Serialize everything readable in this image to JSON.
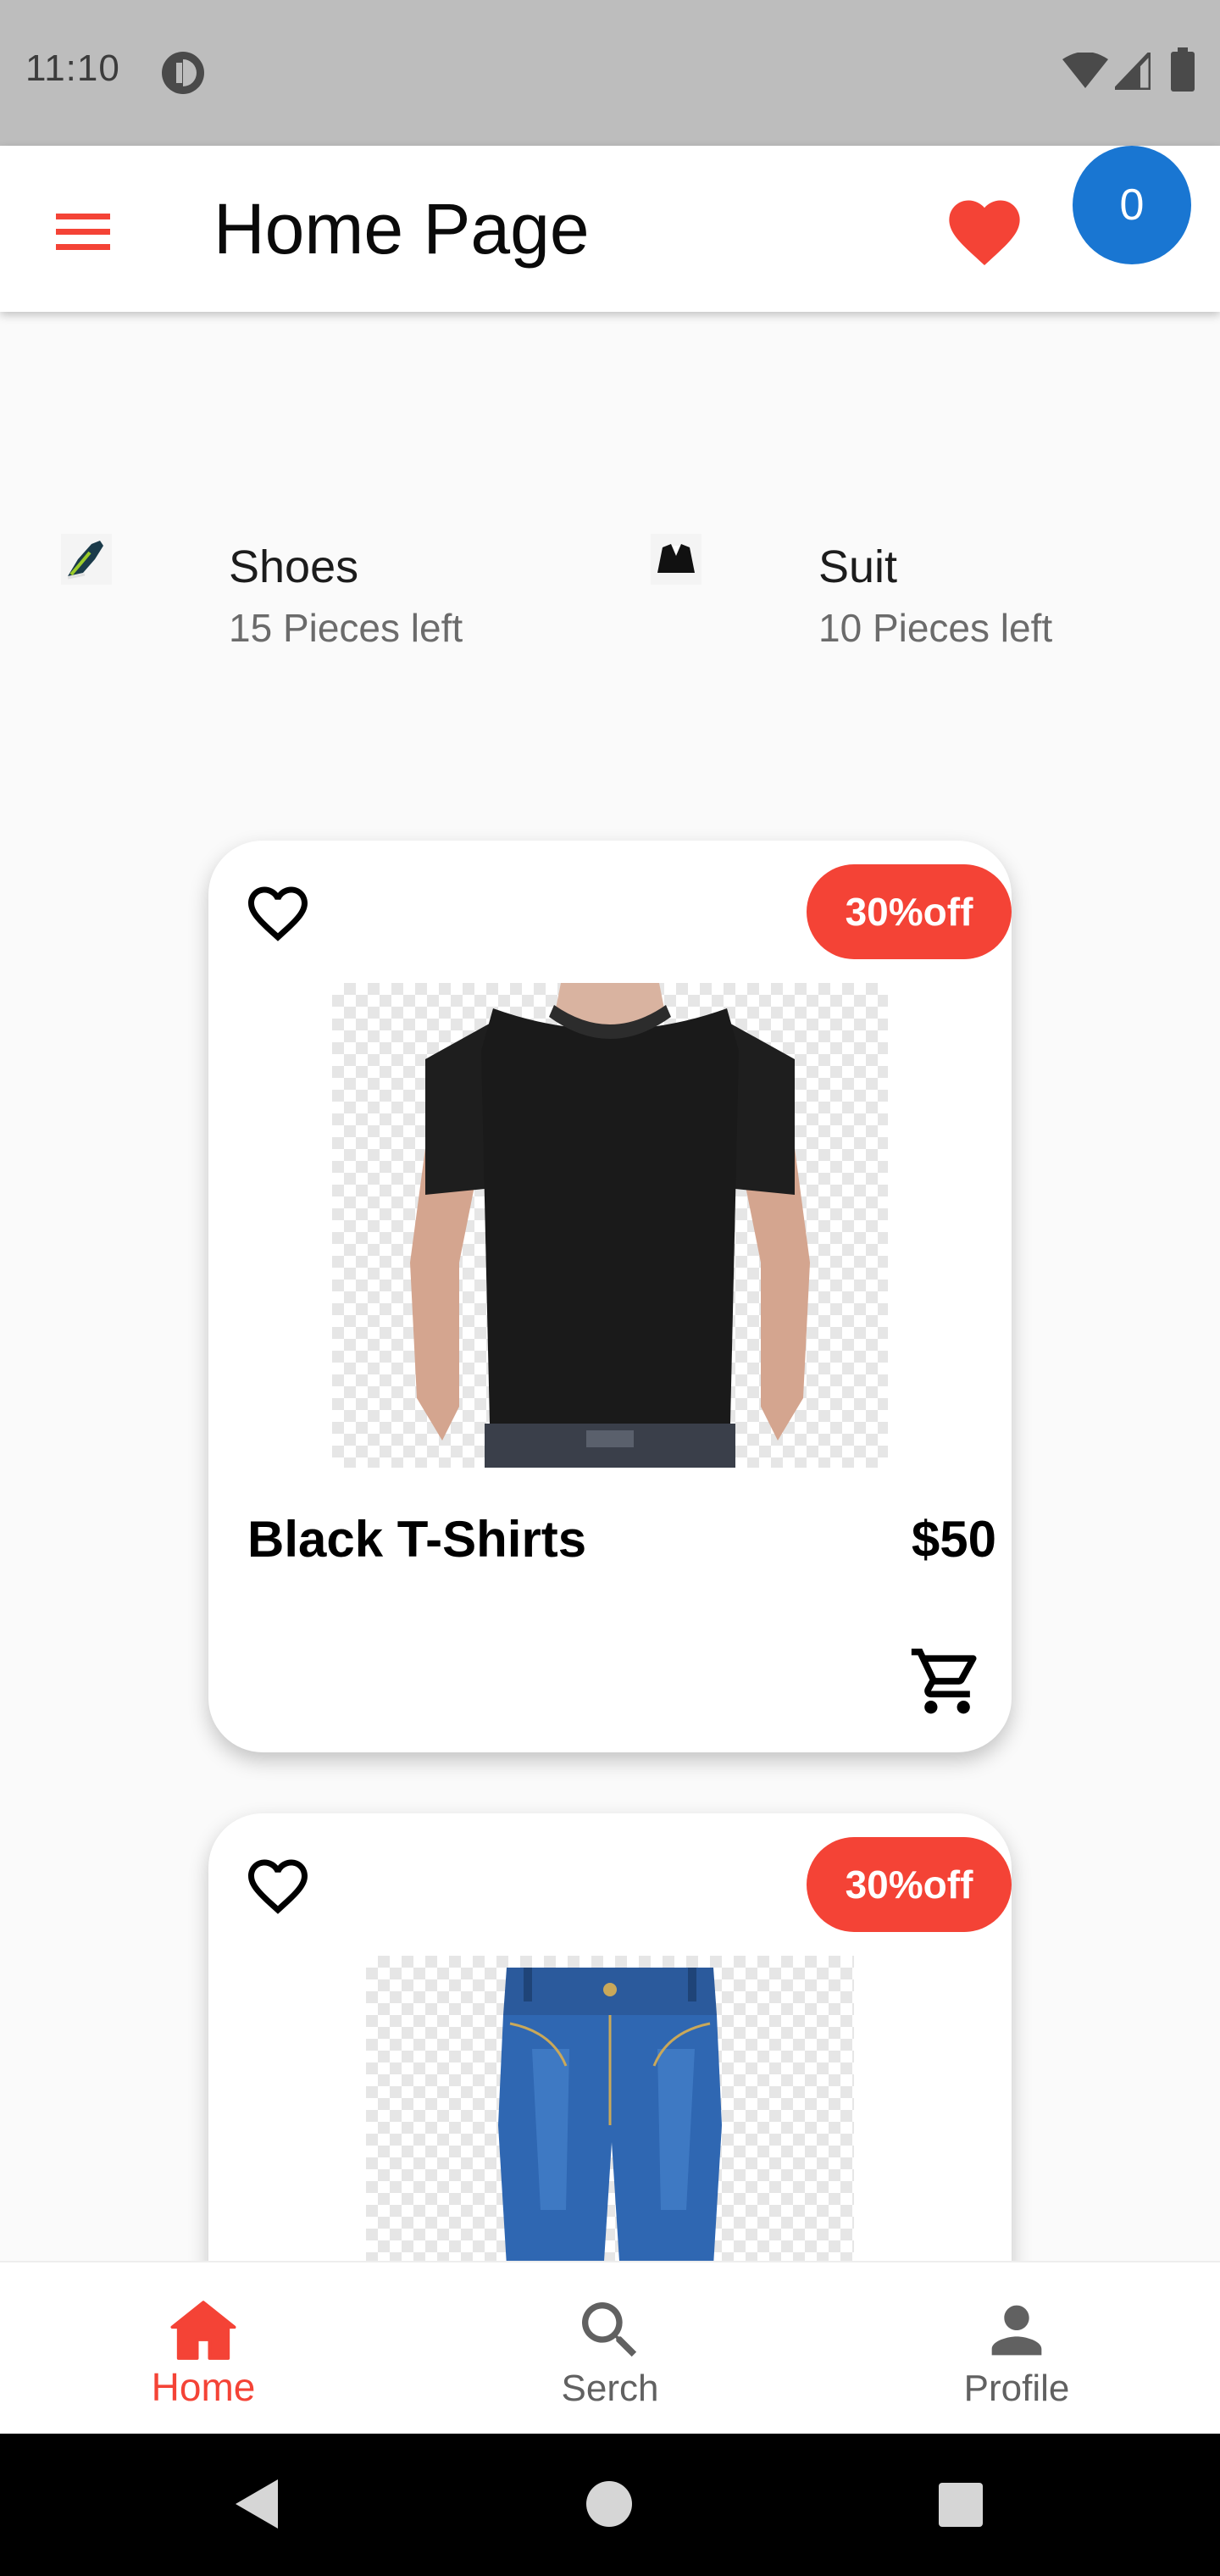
{
  "status_bar": {
    "time": "11:10",
    "icons": [
      "app-notification-icon",
      "wifi-icon",
      "cell-signal-icon",
      "battery-icon"
    ]
  },
  "app_bar": {
    "title": "Home Page",
    "menu_icon": "hamburger-menu-icon",
    "favorite_icon": "heart-filled-icon",
    "cart_count": "0"
  },
  "categories": [
    {
      "icon": "sneaker-icon",
      "name": "Shoes",
      "subtitle": "15 Pieces left"
    },
    {
      "icon": "suit-icon",
      "name": "Suit",
      "subtitle": "10 Pieces left"
    }
  ],
  "products": [
    {
      "name": "Black T-Shirts",
      "price": "$50",
      "discount": "30%off",
      "image": "black-tshirt-photo",
      "favorite_icon": "heart-outline-icon",
      "cart_icon": "cart-icon"
    },
    {
      "discount": "30%off",
      "image": "blue-jeans-photo",
      "favorite_icon": "heart-outline-icon"
    }
  ],
  "bottom_nav": {
    "items": [
      {
        "label": "Home",
        "icon": "home-icon",
        "active": true
      },
      {
        "label": "Serch",
        "icon": "search-icon",
        "active": false
      },
      {
        "label": "Profile",
        "icon": "person-icon",
        "active": false
      }
    ]
  },
  "colors": {
    "accent": "#f44336",
    "badge_blue": "#1976d2",
    "status_bar": "#bdbdbd",
    "background": "#fafafa"
  }
}
